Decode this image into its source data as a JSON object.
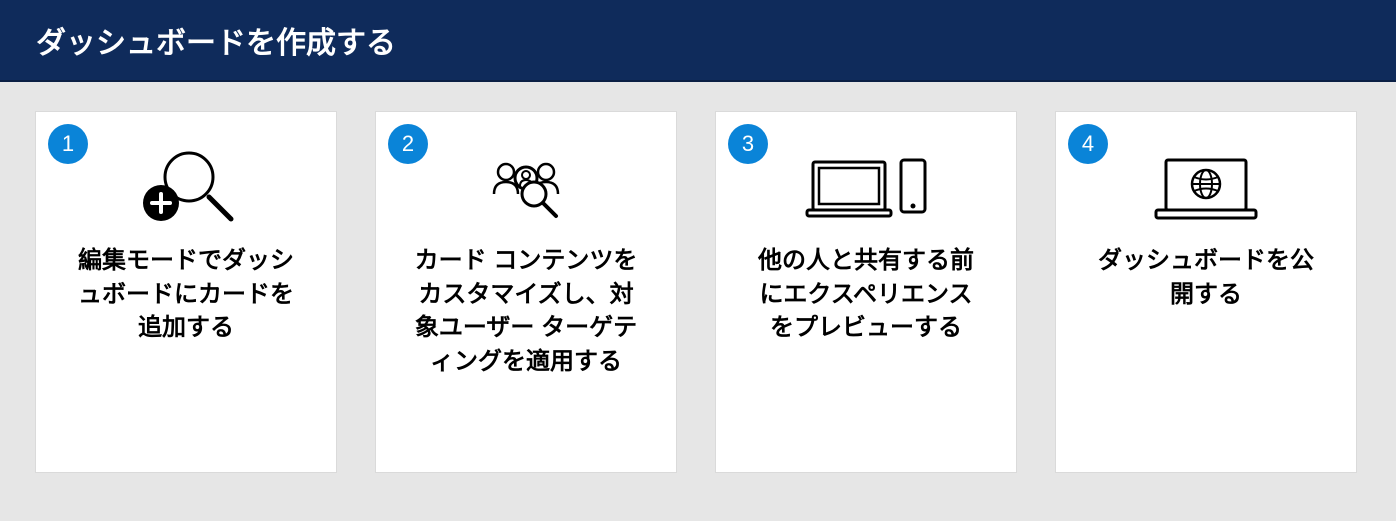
{
  "header": {
    "title": "ダッシュボードを作成する"
  },
  "steps": [
    {
      "num": "1",
      "desc": "編集モードでダッシュボードにカードを追加する"
    },
    {
      "num": "2",
      "desc": "カード コンテンツをカスタマイズし、対象ユーザー ターゲティングを適用する"
    },
    {
      "num": "3",
      "desc": "他の人と共有する前にエクスペリエンスをプレビューする"
    },
    {
      "num": "4",
      "desc": "ダッシュボードを公開する"
    }
  ]
}
